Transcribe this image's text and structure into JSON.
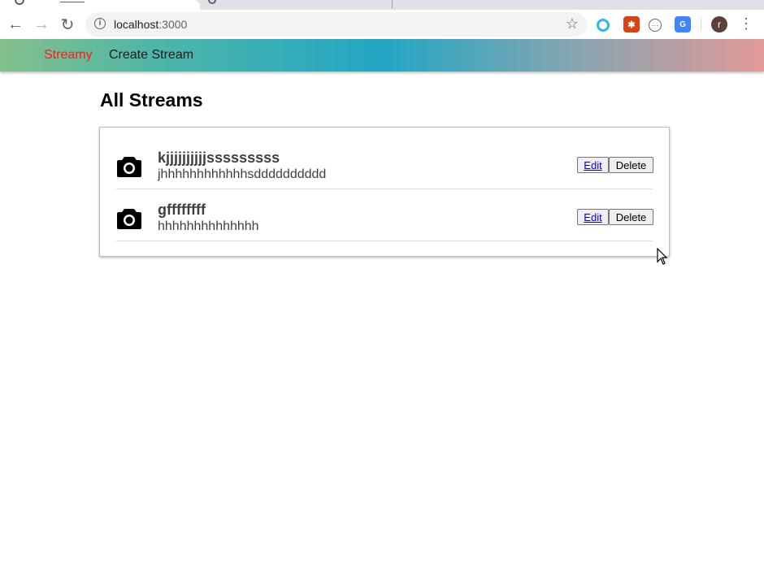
{
  "browser": {
    "url_host": "localhost",
    "url_port": ":3000",
    "avatar_letter": "r"
  },
  "header": {
    "brand": "Streamy",
    "create_link": "Create Stream",
    "brand_color": "#ff1a1a"
  },
  "main": {
    "title": "All Streams",
    "streams": [
      {
        "title": "kjjjjjjjjjjsssssssss",
        "description": "jhhhhhhhhhhhhsdddddddddd",
        "icon": "camera-icon",
        "edit_label": "Edit",
        "delete_label": "Delete"
      },
      {
        "title": "gffffffff",
        "description": "hhhhhhhhhhhhhh",
        "icon": "camera-icon",
        "edit_label": "Edit",
        "delete_label": "Delete"
      }
    ]
  }
}
